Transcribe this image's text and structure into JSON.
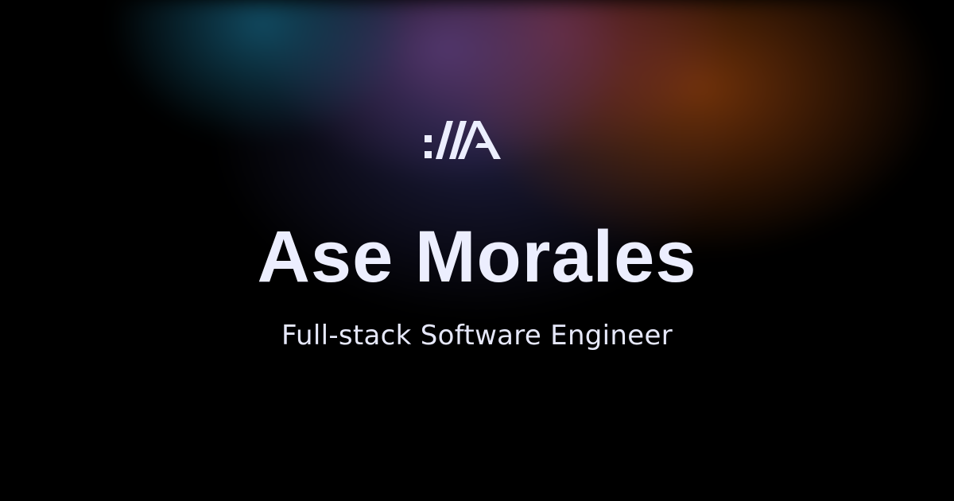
{
  "card": {
    "logo_icon": "colon-double-slash-a-logo",
    "name": "Ase Morales",
    "title": "Full-stack Software Engineer"
  },
  "colors": {
    "background": "#000000",
    "text": "#eceefe",
    "glow_teal": "#124e66",
    "glow_purple": "#583c78",
    "glow_orange": "#7d370a"
  }
}
